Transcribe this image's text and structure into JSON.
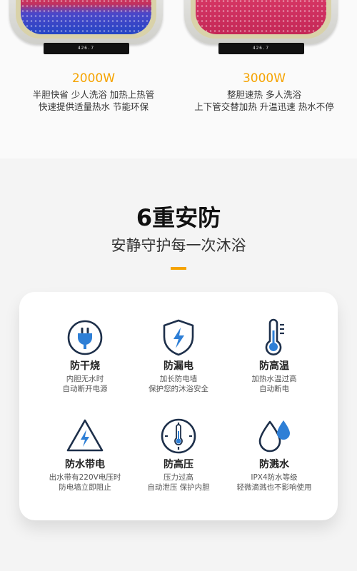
{
  "products": [
    {
      "display": "426.7",
      "wattage": "2000W",
      "lines": [
        "半胆快省 少人洗浴 加热上热管",
        "快速提供适量热水 节能环保"
      ]
    },
    {
      "display": "426.7",
      "wattage": "3000W",
      "lines": [
        "整胆速热 多人洗浴",
        "上下管交替加热  升温迅速   热水不停"
      ]
    }
  ],
  "section": {
    "title": "6重安防",
    "subtitle": "安静守护每一次沐浴"
  },
  "features": [
    {
      "icon": "plug-icon",
      "name": "防干烧",
      "lines": [
        "内胆无水时",
        "自动断开电源"
      ]
    },
    {
      "icon": "shield-lightning-icon",
      "name": "防漏电",
      "lines": [
        "加长防电墙",
        "保护您的沐浴安全"
      ]
    },
    {
      "icon": "thermometer-icon",
      "name": "防高温",
      "lines": [
        "加热水温过高",
        "自动断电"
      ]
    },
    {
      "icon": "warning-lightning-icon",
      "name": "防水带电",
      "lines": [
        "出水带有220V电压时",
        "防电墙立即阻止"
      ]
    },
    {
      "icon": "pressure-gauge-icon",
      "name": "防高压",
      "lines": [
        "压力过高",
        "自动泄压 保护内胆"
      ]
    },
    {
      "icon": "water-drops-icon",
      "name": "防溅水",
      "lines": [
        "IPX4防水等级",
        "轻微滴溅也不影响使用"
      ]
    }
  ],
  "colors": {
    "accent": "#f5a300",
    "icon_blue": "#2e7fd6",
    "icon_dark": "#1d2f4a"
  }
}
